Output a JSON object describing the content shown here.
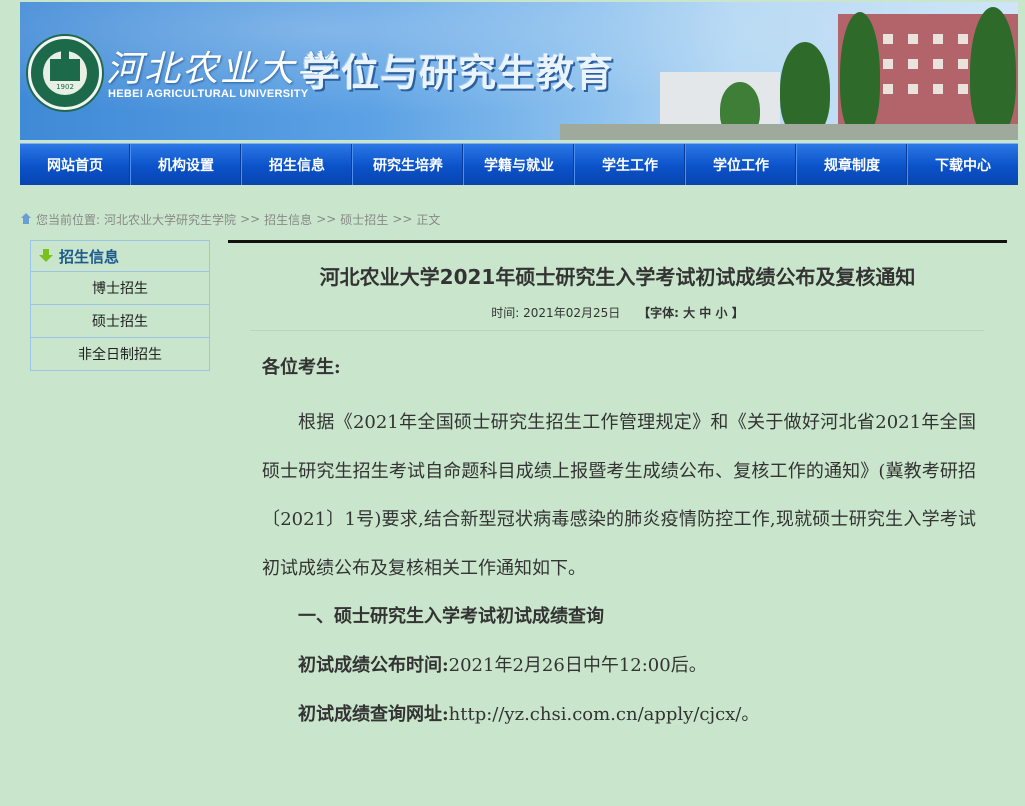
{
  "banner": {
    "calligraphy": "河北农业大学",
    "english_name": "HEBEI AGRICULTURAL UNIVERSITY",
    "title": "学位与研究生教育",
    "logo_year": "1902"
  },
  "nav": {
    "items": [
      "网站首页",
      "机构设置",
      "招生信息",
      "研究生培养",
      "学籍与就业",
      "学生工作",
      "学位工作",
      "规章制度",
      "下载中心"
    ]
  },
  "breadcrumb": {
    "prefix": "您当前位置:",
    "items": [
      "河北农业大学研究生学院",
      "招生信息",
      "硕士招生",
      "正文"
    ],
    "separator": ">>"
  },
  "sidebar": {
    "title": "招生信息",
    "items": [
      "博士招生",
      "硕士招生",
      "非全日制招生"
    ]
  },
  "article": {
    "title": "河北农业大学2021年硕士研究生入学考试初试成绩公布及复核通知",
    "time_label": "时间:",
    "date": "2021年02月25日",
    "font_label": "【字体:",
    "font_large": "大",
    "font_medium": "中",
    "font_small": "小",
    "font_close": "】",
    "greeting": "各位考生:",
    "para1": "根据《2021年全国硕士研究生招生工作管理规定》和《关于做好河北省2021年全国硕士研究生招生考试自命题科目成绩上报暨考生成绩公布、复核工作的通知》(冀教考研招〔2021〕1号)要求,结合新型冠状病毒感染的肺炎疫情防控工作,现就硕士研究生入学考试初试成绩公布及复核相关工作通知如下。",
    "section1": "一、硕士研究生入学考试初试成绩查询",
    "time_item_label": "初试成绩公布时间:",
    "time_item_value": "2021年2月26日中午12:00后。",
    "url_item_label": "初试成绩查询网址:",
    "url_item_value": "http://yz.chsi.com.cn/apply/cjcx/。"
  },
  "colors": {
    "page_bg": "#c9e6cc",
    "nav_bg": "#0b52c9",
    "sidebar_title": "#1d5a8e",
    "sidebar_border": "#9dc3e6"
  },
  "icons": [
    "home-icon",
    "arrow-down-icon",
    "logo-seal"
  ]
}
